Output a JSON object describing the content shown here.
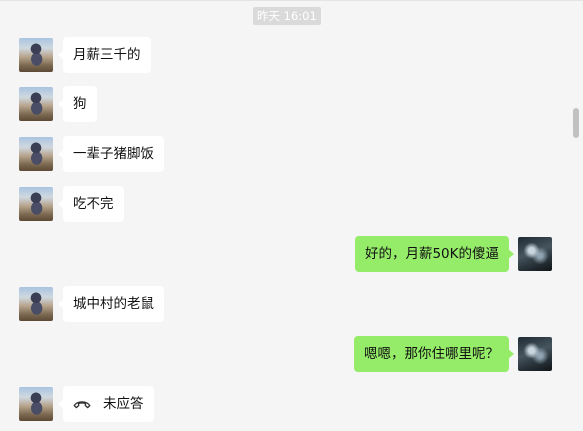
{
  "time_separator": "昨天 16:01",
  "messages": [
    {
      "side": "left",
      "text": "月薪三千的"
    },
    {
      "side": "left",
      "text": "狗"
    },
    {
      "side": "left",
      "text": "一辈子猪脚饭"
    },
    {
      "side": "left",
      "text": "吃不完"
    },
    {
      "side": "right",
      "text": "好的，月薪50K的傻逼"
    },
    {
      "side": "left",
      "text": "城中村的老鼠"
    },
    {
      "side": "right",
      "text": "嗯嗯，那你住哪里呢？"
    },
    {
      "side": "left",
      "text": "未应答",
      "icon": "phone-hangup-icon"
    }
  ],
  "colors": {
    "background": "#f5f5f5",
    "bubble_incoming": "#ffffff",
    "bubble_outgoing": "#95ec69",
    "time_badge": "#dadada"
  }
}
